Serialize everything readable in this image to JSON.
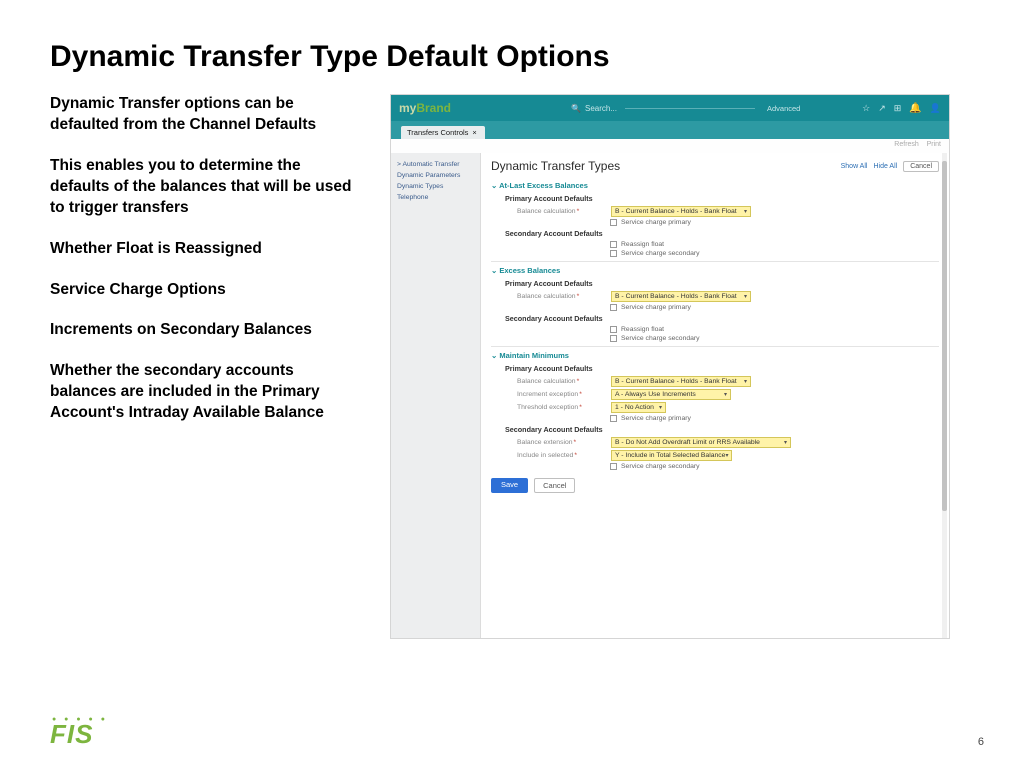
{
  "title": "Dynamic Transfer Type Default Options",
  "bullets": {
    "b1": "Dynamic Transfer options can be defaulted from the Channel Defaults",
    "b2": "This enables you to determine the defaults of the balances that will be used to trigger transfers",
    "b3": "Whether Float is Reassigned",
    "b4": "Service Charge Options",
    "b5": "Increments on Secondary Balances",
    "b6": "Whether the secondary accounts balances are included in the Primary Account's Intraday Available Balance"
  },
  "screenshot": {
    "brand_my": "my",
    "brand_name": "Brand",
    "search_placeholder": "Search...",
    "advanced": "Advanced",
    "tab": "Transfers Controls",
    "tab_close": "×",
    "meta_refresh": "Refresh",
    "meta_print": "Print",
    "side": {
      "s1": "> Automatic Transfer",
      "s2": "Dynamic Parameters",
      "s3": "Dynamic Types",
      "s4": "Telephone"
    },
    "page_title": "Dynamic Transfer Types",
    "show_all": "Show All",
    "hide_all": "Hide All",
    "top_cancel": "Cancel",
    "sec1": {
      "head": "⌄  At-Last Excess Balances",
      "primary": "Primary Account Defaults",
      "balcalc_lbl": "Balance calculation",
      "balcalc_val": "B - Current Balance - Holds - Bank Float",
      "scp": "Service charge primary",
      "secondary": "Secondary Account Defaults",
      "rf": "Reassign float",
      "scs": "Service charge secondary"
    },
    "sec2": {
      "head": "⌄  Excess Balances",
      "primary": "Primary Account Defaults",
      "balcalc_lbl": "Balance calculation",
      "balcalc_val": "B - Current Balance - Holds - Bank Float",
      "scp": "Service charge primary",
      "secondary": "Secondary Account Defaults",
      "rf": "Reassign float",
      "scs": "Service charge secondary"
    },
    "sec3": {
      "head": "⌄  Maintain Minimums",
      "primary": "Primary Account Defaults",
      "balcalc_lbl": "Balance calculation",
      "balcalc_val": "B - Current Balance - Holds - Bank Float",
      "inc_lbl": "Increment exception",
      "inc_val": "A - Always Use Increments",
      "thr_lbl": "Threshold exception",
      "thr_val": "1 - No Action",
      "scp": "Service charge primary",
      "secondary": "Secondary Account Defaults",
      "ext_lbl": "Balance extension",
      "ext_val": "B - Do Not Add Overdraft Limit or RRS Available",
      "incsel_lbl": "Include in selected",
      "incsel_val": "Y - Include in Total Selected Balance",
      "scs": "Service charge secondary"
    },
    "save": "Save",
    "cancel": "Cancel"
  },
  "footer": {
    "logo": "FIS",
    "page": "6"
  }
}
